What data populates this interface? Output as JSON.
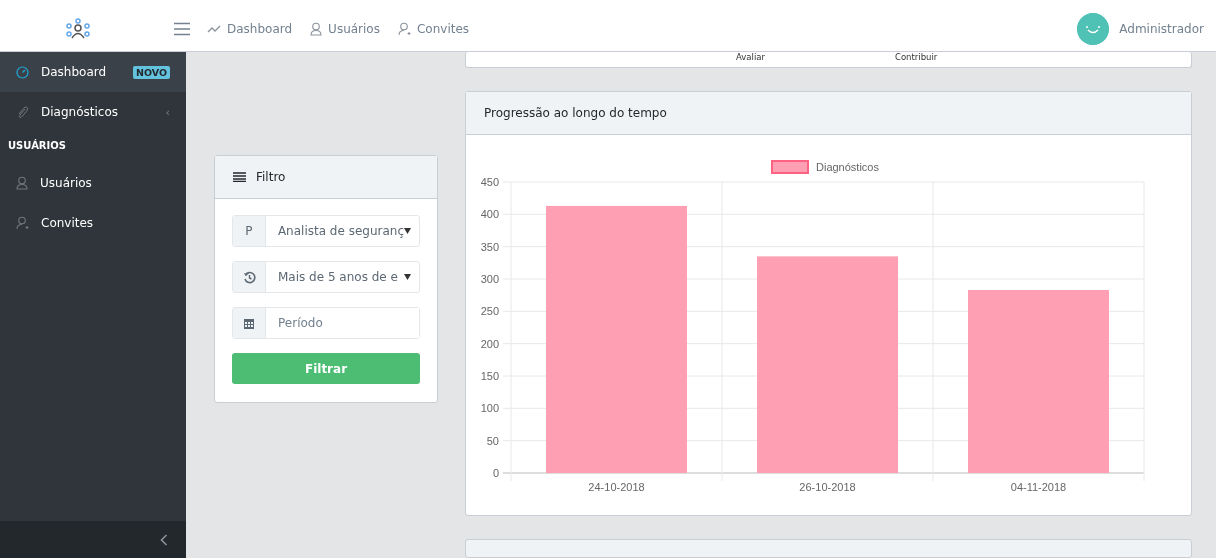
{
  "header": {
    "nav": [
      {
        "label": "Dashboard"
      },
      {
        "label": "Usuários"
      },
      {
        "label": "Convites"
      }
    ],
    "user": "Administrador"
  },
  "sidebar": {
    "items": [
      {
        "kind": "item",
        "label": "Dashboard",
        "badge": "NOVO",
        "selected": true
      },
      {
        "kind": "item",
        "label": "Diagnósticos",
        "caret": "‹",
        "selected": false
      },
      {
        "kind": "heading",
        "label": "USUÁRIOS"
      },
      {
        "kind": "item",
        "label": "Usuários",
        "selected": false
      },
      {
        "kind": "item",
        "label": "Convites",
        "selected": false
      }
    ]
  },
  "top_card": {
    "labels": [
      "Avaliar",
      "Contribuir"
    ]
  },
  "filter": {
    "title": "Filtro",
    "fields": [
      {
        "kind": "select",
        "addon": "P",
        "value": "Analista de seguranç"
      },
      {
        "kind": "select",
        "value": "Mais de 5 anos de e"
      },
      {
        "kind": "input",
        "placeholder": "Período"
      }
    ],
    "button": "Filtrar"
  },
  "chart_card": {
    "title": "Progressão ao longo do tempo",
    "chart_data": {
      "type": "bar",
      "categories": [
        "24-10-2018",
        "26-10-2018",
        "04-11-2018"
      ],
      "series": [
        {
          "name": "Diagnósticos",
          "color": "#ff9fb3",
          "values": [
            413,
            335,
            283
          ]
        }
      ],
      "ylim": [
        0,
        450
      ],
      "grid": true,
      "yticks": [
        0,
        50,
        100,
        150,
        200,
        250,
        300,
        350,
        400,
        450
      ]
    }
  }
}
